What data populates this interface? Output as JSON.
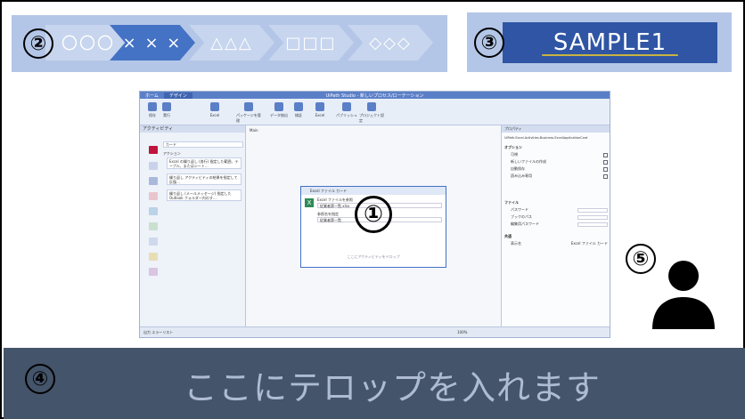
{
  "steps": {
    "number": "②",
    "items": [
      {
        "label": "〇〇〇",
        "state": "inactive"
      },
      {
        "label": "× × ×",
        "state": "active"
      },
      {
        "label": "△△△",
        "state": "inactive"
      },
      {
        "label": "□□□",
        "state": "inactive"
      },
      {
        "label": "◇◇◇",
        "state": "inactive"
      }
    ]
  },
  "sample": {
    "number": "③",
    "label": "SAMPLE1"
  },
  "screenshot": {
    "number": "①",
    "tabs": [
      "ホーム",
      "デザイン"
    ],
    "title": "UiPath Studio - 新しいプロセス/ローテーション",
    "ribbon_buttons": [
      "保存",
      "実行",
      "Excel",
      "パッケージを管理",
      "データ抽出",
      "検証",
      "Excel",
      "パブリッシュ",
      "プロジェクト設定"
    ],
    "left_pane": {
      "title": "アクティビティ",
      "search_label": "カード",
      "section": "アクション",
      "items": [
        "Excel の繰り返し (各行) 指定した範囲、テーブル、またはシート…",
        "繰り返し アクティビティの結果を指定して反復…",
        "繰り返し (メールメッセージ) 指定した Outlook フォルダー内のす…"
      ]
    },
    "canvas": {
      "tab": "Main",
      "card_title": "Excel ファイル カード",
      "rows": [
        "Excel ファイルを参照",
        "従業者第一覧.xlsx",
        "参照名を指定",
        "従業者第一覧"
      ],
      "drop_hint": "ここにアクティビティをドロップ"
    },
    "right_pane": {
      "title": "プロパティ",
      "path": "UiPath.Excel.Activities.Business.ExcelApplicationCard",
      "section_options": "オプション",
      "options": [
        "可視",
        "新しいファイルの作成",
        "自動保存",
        "読み込み専用"
      ],
      "section_file": "ファイル",
      "file_rows": [
        "パスワード",
        "ブックのパス",
        "編集用パスワード"
      ],
      "section_misc": "共通",
      "display_name_label": "表示名",
      "display_name_value": "Excel ファイル カード"
    },
    "statusbar": "出力  エラーリスト",
    "zoom": "100%"
  },
  "presenter": {
    "number": "⑤",
    "icon": "person-icon"
  },
  "caption": {
    "number": "④",
    "text": "ここにテロップを入れます"
  },
  "colors": {
    "banner_bg": "#b4c6e7",
    "chevron_active": "#4472c4",
    "sample_box": "#2f55a4",
    "caption_bg": "#44546a",
    "caption_text": "#aebcd2"
  }
}
